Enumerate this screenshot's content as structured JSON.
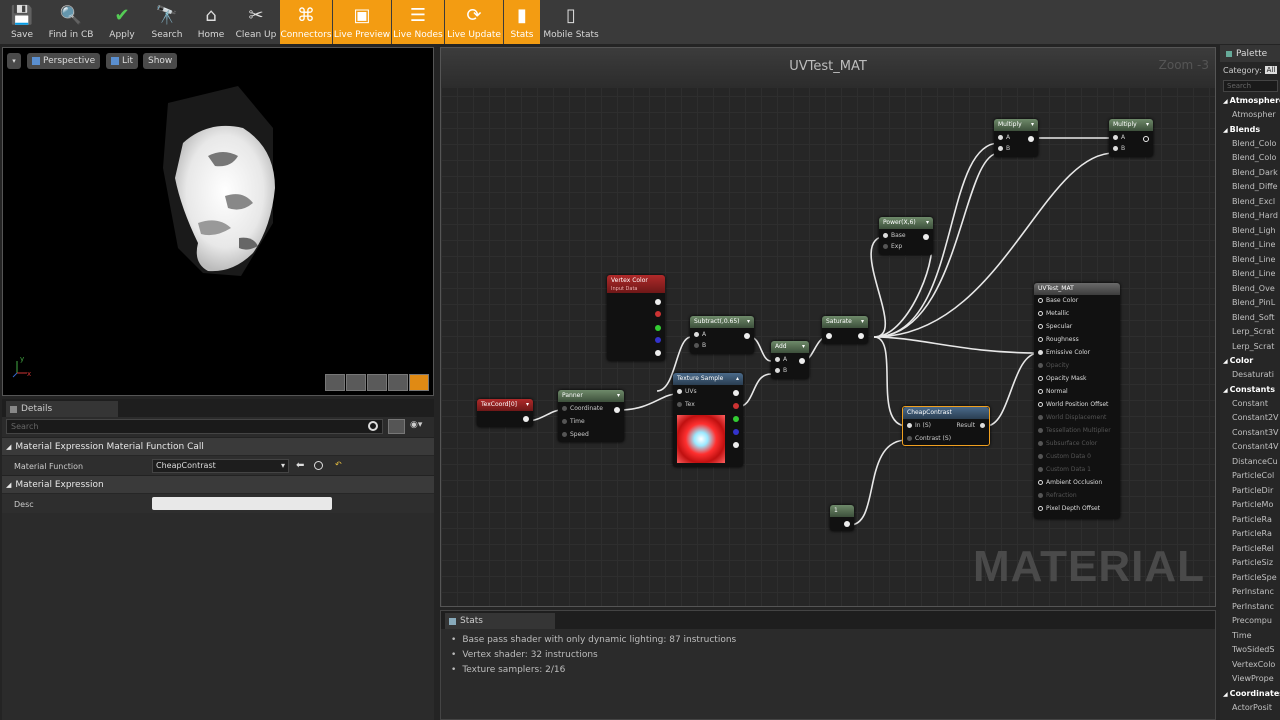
{
  "toolbar": {
    "buttons": [
      {
        "label": "Save",
        "icon": "save-icon",
        "active": false
      },
      {
        "label": "Find in CB",
        "icon": "find-in-cb-icon",
        "active": false
      },
      {
        "label": "Apply",
        "icon": "apply-check-icon",
        "active": false
      },
      {
        "label": "Search",
        "icon": "search-icon",
        "active": false
      },
      {
        "label": "Home",
        "icon": "home-icon",
        "active": false
      },
      {
        "label": "Clean Up",
        "icon": "clean-up-icon",
        "active": false
      },
      {
        "label": "Connectors",
        "icon": "connectors-icon",
        "active": true
      },
      {
        "label": "Live Preview",
        "icon": "live-preview-icon",
        "active": true
      },
      {
        "label": "Live Nodes",
        "icon": "live-nodes-icon",
        "active": true
      },
      {
        "label": "Live Update",
        "icon": "live-update-icon",
        "active": true
      },
      {
        "label": "Stats",
        "icon": "stats-icon",
        "active": true
      },
      {
        "label": "Mobile Stats",
        "icon": "mobile-stats-icon",
        "active": false
      }
    ]
  },
  "viewport": {
    "perspective_label": "Perspective",
    "lit_label": "Lit",
    "show_label": "Show",
    "axis_y": "y",
    "axis_x": "x"
  },
  "details": {
    "tab_label": "Details",
    "search_placeholder": "Search",
    "categories": [
      {
        "title": "Material Expression Material Function Call",
        "prop_label": "Material Function",
        "prop_value": "CheapContrast"
      },
      {
        "title": "Material Expression",
        "prop_label": "Desc",
        "prop_value": ""
      }
    ]
  },
  "graph": {
    "title": "UVTest_MAT",
    "zoom": "Zoom -3",
    "watermark": "MATERIAL",
    "nodes": {
      "vertex_color": {
        "title": "Vertex Color",
        "subtitle": "Input Data"
      },
      "subtract": {
        "title": "Subtract(,0.65)",
        "pins": [
          "A",
          "B"
        ]
      },
      "add": {
        "title": "Add",
        "pins": [
          "A",
          "B"
        ]
      },
      "saturate": {
        "title": "Saturate"
      },
      "power": {
        "title": "Power(X,6)",
        "pins": [
          "Base",
          "Exp"
        ]
      },
      "multiply1": {
        "title": "Multiply",
        "pins": [
          "A",
          "B"
        ]
      },
      "multiply2": {
        "title": "Multiply",
        "pins": [
          "A",
          "B"
        ]
      },
      "texcoord": {
        "title": "TexCoord[0]"
      },
      "panner": {
        "title": "Panner",
        "pins": [
          "Coordinate",
          "Time",
          "Speed"
        ]
      },
      "texture_sample": {
        "title": "Texture Sample",
        "pins": [
          "UVs",
          "Tex"
        ]
      },
      "cheap_contrast": {
        "title": "CheapContrast",
        "pins": [
          "In (S)",
          "Contrast (S)"
        ],
        "output": "Result"
      },
      "constant": {
        "title": "1"
      },
      "result": {
        "title": "UVTest_MAT",
        "pins": [
          {
            "label": "Base Color",
            "enabled": true
          },
          {
            "label": "Metallic",
            "enabled": true
          },
          {
            "label": "Specular",
            "enabled": true
          },
          {
            "label": "Roughness",
            "enabled": true
          },
          {
            "label": "Emissive Color",
            "enabled": true
          },
          {
            "label": "Opacity",
            "enabled": false
          },
          {
            "label": "Opacity Mask",
            "enabled": true
          },
          {
            "label": "Normal",
            "enabled": true
          },
          {
            "label": "World Position Offset",
            "enabled": true
          },
          {
            "label": "World Displacement",
            "enabled": false
          },
          {
            "label": "Tessellation Multiplier",
            "enabled": false
          },
          {
            "label": "Subsurface Color",
            "enabled": false
          },
          {
            "label": "Custom Data 0",
            "enabled": false
          },
          {
            "label": "Custom Data 1",
            "enabled": false
          },
          {
            "label": "Ambient Occlusion",
            "enabled": true
          },
          {
            "label": "Refraction",
            "enabled": false
          },
          {
            "label": "Pixel Depth Offset",
            "enabled": true
          }
        ]
      }
    }
  },
  "stats": {
    "tab_label": "Stats",
    "lines": [
      "Base pass shader with only dynamic lighting: 87 instructions",
      "Vertex shader: 32 instructions",
      "Texture samplers: 2/16"
    ]
  },
  "palette": {
    "tab_label": "Palette",
    "category_label": "Category:",
    "category_value": "All",
    "search_placeholder": "Search",
    "groups": [
      {
        "title": "Atmosphere",
        "items": [
          "Atmospher"
        ]
      },
      {
        "title": "Blends",
        "items": [
          "Blend_Colo",
          "Blend_Colo",
          "Blend_Dark",
          "Blend_Diffe",
          "Blend_Excl",
          "Blend_Hard",
          "Blend_Ligh",
          "Blend_Line",
          "Blend_Line",
          "Blend_Line",
          "Blend_Ove",
          "Blend_PinL",
          "Blend_Soft",
          "Lerp_Scrat",
          "Lerp_Scrat"
        ]
      },
      {
        "title": "Color",
        "items": [
          "Desaturati"
        ]
      },
      {
        "title": "Constants",
        "items": [
          "Constant",
          "Constant2V",
          "Constant3V",
          "Constant4V",
          "DistanceCu",
          "ParticleCol",
          "ParticleDir",
          "ParticleMo",
          "ParticleRa",
          "ParticleRa",
          "ParticleRel",
          "ParticleSiz",
          "ParticleSpe",
          "PerInstanc",
          "PerInstanc",
          "Precompu",
          "Time",
          "TwoSidedS",
          "VertexColo",
          "ViewPrope"
        ]
      },
      {
        "title": "Coordinates",
        "items": [
          "ActorPosit"
        ]
      }
    ]
  },
  "colors": {
    "accent": "#f39c12",
    "node_selected": "#f0a020"
  }
}
